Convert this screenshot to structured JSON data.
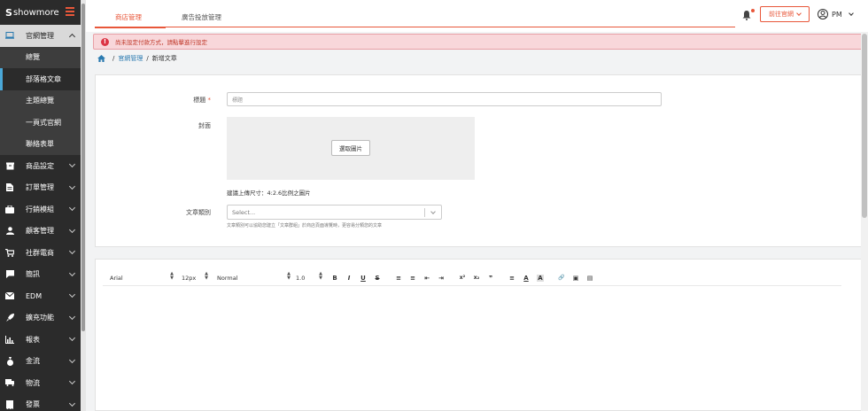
{
  "sidebar": {
    "logo_mark": "S",
    "logo_text": "showmore",
    "items": [
      {
        "label": "官網管理",
        "icon": "laptop-icon",
        "open": true
      },
      {
        "label": "商品設定",
        "icon": "box-icon"
      },
      {
        "label": "訂單管理",
        "icon": "document-icon"
      },
      {
        "label": "行銷模組",
        "icon": "briefcase-icon"
      },
      {
        "label": "顧客管理",
        "icon": "user-icon"
      },
      {
        "label": "社群電商",
        "icon": "cart-icon"
      },
      {
        "label": "簡訊",
        "icon": "chat-icon"
      },
      {
        "label": "EDM",
        "icon": "envelope-icon"
      },
      {
        "label": "擴充功能",
        "icon": "rocket-icon"
      },
      {
        "label": "報表",
        "icon": "bar-chart-icon"
      },
      {
        "label": "金流",
        "icon": "money-bag-icon"
      },
      {
        "label": "物流",
        "icon": "truck-icon"
      },
      {
        "label": "發票",
        "icon": "receipt-icon"
      }
    ],
    "subitems": [
      {
        "label": "總覽"
      },
      {
        "label": "部落格文章",
        "active": true
      },
      {
        "label": "主題總覽"
      },
      {
        "label": "一頁式官網"
      },
      {
        "label": "聯絡表單"
      }
    ]
  },
  "topbar": {
    "tabs": [
      "商店管理",
      "廣告投放管理"
    ],
    "goto_label": "前往官網",
    "user_label": "PM"
  },
  "alert": {
    "text": "尚未設定付款方式，請點擊進行設定"
  },
  "breadcrumb": {
    "link": "官網管理",
    "current": "新增文章"
  },
  "form": {
    "title_label": "標題",
    "title_required": "*",
    "title_placeholder": "標題",
    "cover_label": "封面",
    "pick_image_label": "選取圖片",
    "cover_hint": "建議上傳尺寸：4:2.6比例之圖片",
    "category_label": "文章類別",
    "category_placeholder": "Select...",
    "category_hint": "文章類別可以協助您建立「文章群組」於商店頁面導覽時，更容易分類您的文章"
  },
  "editor": {
    "font": "Arial",
    "size": "12px",
    "style": "Normal",
    "line_height": "1.0",
    "buttons": [
      {
        "label": "B",
        "icon": "bold-icon"
      },
      {
        "label": "I",
        "icon": "italic-icon"
      },
      {
        "label": "U",
        "icon": "underline-icon"
      },
      {
        "label": "S",
        "icon": "strike-icon"
      },
      {
        "label": "≡",
        "icon": "ordered-list-icon"
      },
      {
        "label": "≡",
        "icon": "bullet-list-icon"
      },
      {
        "label": "⇤",
        "icon": "outdent-icon"
      },
      {
        "label": "⇥",
        "icon": "indent-icon"
      },
      {
        "label": "x²",
        "icon": "superscript-icon"
      },
      {
        "label": "x₂",
        "icon": "subscript-icon"
      },
      {
        "label": "❞",
        "icon": "blockquote-icon"
      },
      {
        "label": "≡",
        "icon": "align-icon"
      },
      {
        "label": "A",
        "icon": "font-color-icon"
      },
      {
        "label": "A",
        "icon": "background-color-icon"
      },
      {
        "label": "🔗",
        "icon": "link-icon"
      },
      {
        "label": "▣",
        "icon": "image-icon"
      },
      {
        "label": "▤",
        "icon": "video-icon"
      }
    ]
  },
  "colors": {
    "accent": "#e8573a",
    "sidebar_bg": "#2b2b2b",
    "alert_bg": "#f8d7da",
    "link": "#2a7ab0"
  }
}
